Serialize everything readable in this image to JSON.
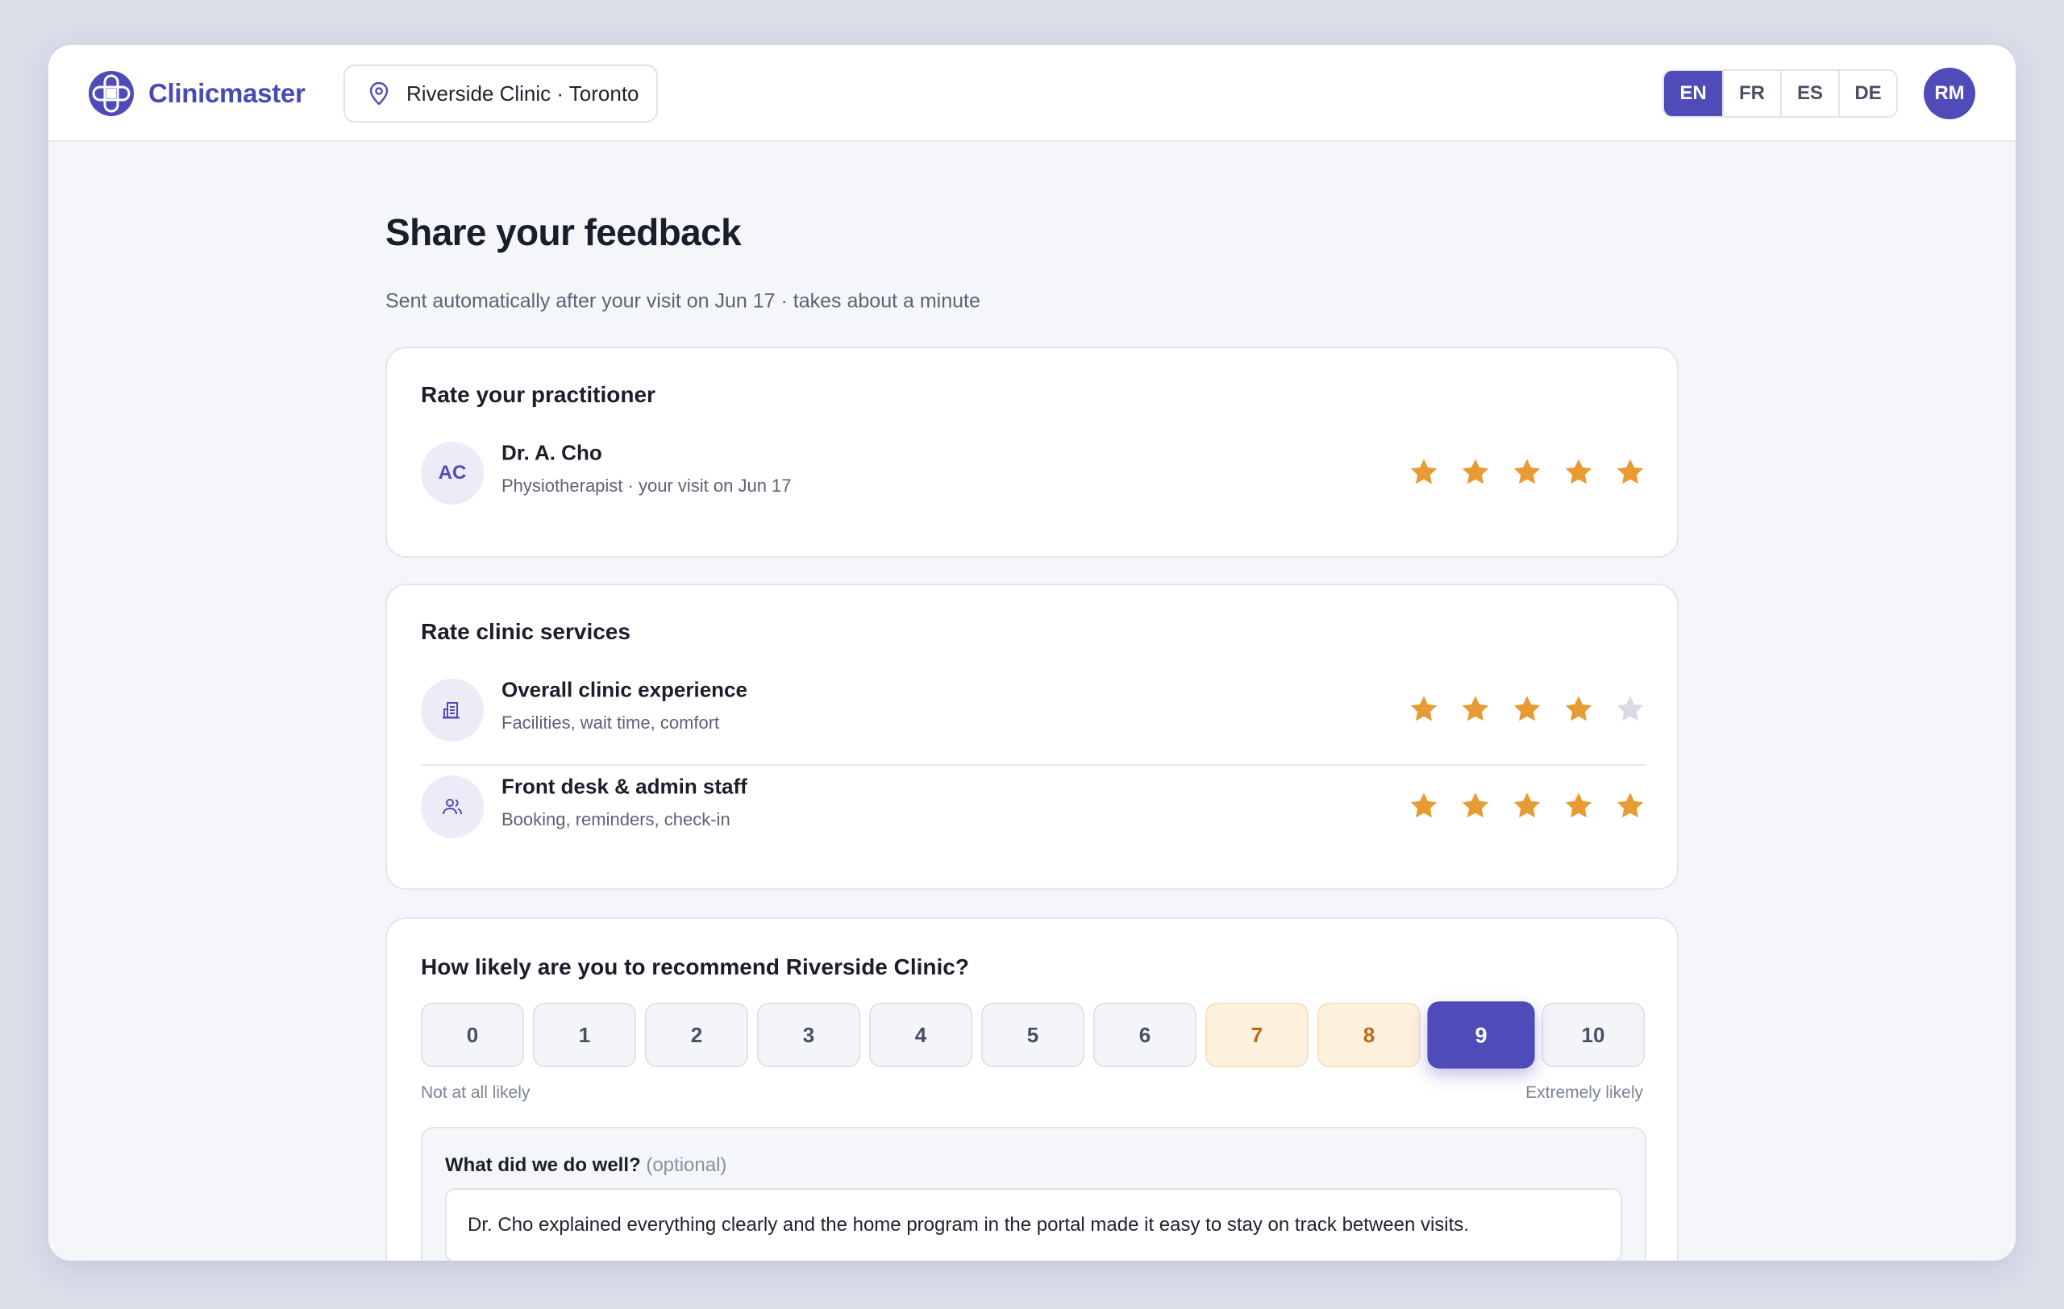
{
  "app": {
    "name": "Clinicmaster",
    "location": "Riverside Clinic · Toronto",
    "languages": [
      {
        "code": "EN",
        "active": true
      },
      {
        "code": "FR",
        "active": false
      },
      {
        "code": "ES",
        "active": false
      },
      {
        "code": "DE",
        "active": false
      }
    ],
    "user_initials": "RM"
  },
  "page": {
    "title": "Share your feedback",
    "subtitle": "Sent automatically after your visit on Jun 17 · takes about a minute"
  },
  "practitioner_card": {
    "title": "Rate your practitioner",
    "practitioner": {
      "initials": "AC",
      "name": "Dr. A. Cho",
      "detail": "Physiotherapist · your visit on Jun 17",
      "rating": 5,
      "max_rating": 5
    }
  },
  "services_card": {
    "title": "Rate clinic services",
    "items": [
      {
        "icon": "building-icon",
        "title": "Overall clinic experience",
        "detail": "Facilities, wait time, comfort",
        "rating": 4,
        "max_rating": 5
      },
      {
        "icon": "users-icon",
        "title": "Front desk & admin staff",
        "detail": "Booking, reminders, check-in",
        "rating": 5,
        "max_rating": 5
      }
    ]
  },
  "recommend_card": {
    "title": "How likely are you to recommend Riverside Clinic?",
    "scale": [
      "0",
      "1",
      "2",
      "3",
      "4",
      "5",
      "6",
      "7",
      "8",
      "9",
      "10"
    ],
    "selected": 9,
    "low_label": "Not at all likely",
    "high_label": "Extremely likely",
    "feedback": {
      "label": "What did we do well?",
      "optional": "(optional)",
      "value": "Dr. Cho explained everything clearly and the home program in the portal made it easy to stay on track between visits."
    }
  },
  "colors": {
    "accent": "#4f4bb8",
    "star_filled": "#e89b32",
    "star_empty": "#d9dbe4",
    "nps_warm_bg": "#fdf0dc",
    "nps_warm_text": "#c2660f"
  }
}
